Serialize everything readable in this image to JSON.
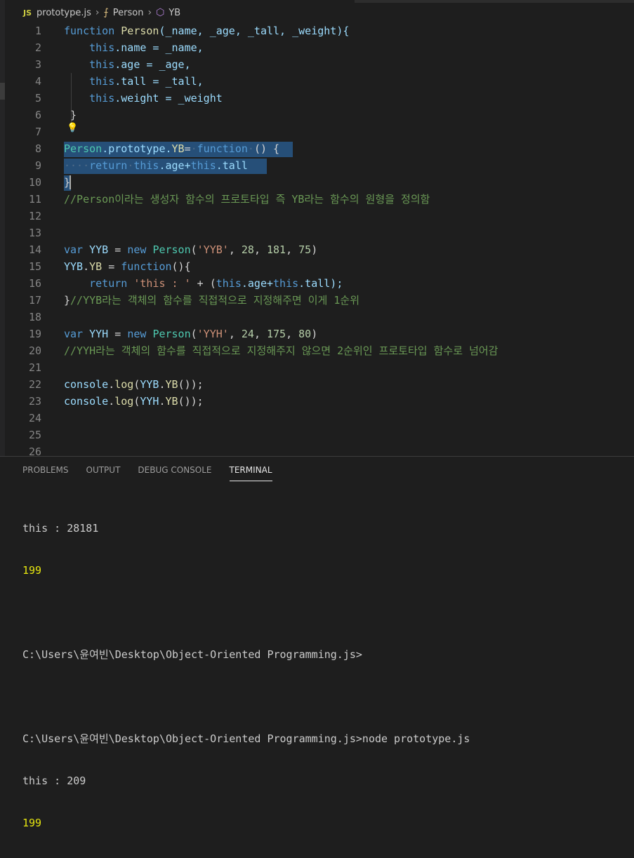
{
  "breadcrumb": {
    "file_badge": "JS",
    "file": "prototype.js",
    "symbol1": "Person",
    "symbol2": "YB"
  },
  "editor": {
    "line_numbers": [
      "1",
      "2",
      "3",
      "4",
      "5",
      "6",
      "7",
      "8",
      "9",
      "10",
      "11",
      "12",
      "13",
      "14",
      "15",
      "16",
      "17",
      "18",
      "19",
      "20",
      "21",
      "22",
      "23",
      "24",
      "25",
      "26"
    ],
    "lines": {
      "l1": {
        "a": "function",
        "b": "Person",
        "c": "(_name, _age, _tall, _weight){"
      },
      "l2": {
        "a": "this",
        "b": ".name = _name,",
        "c": ""
      },
      "l3": {
        "a": "this",
        "b": ".age = _age,",
        "c": ""
      },
      "l4": {
        "a": "this",
        "b": ".tall = _tall,",
        "c": ""
      },
      "l5": {
        "a": "this",
        "b": ".weight = _weight",
        "c": ""
      },
      "l6": {
        "a": "}",
        "b": "",
        "c": ""
      },
      "l8": {
        "a": "Person",
        "b": ".prototype.",
        "c": "YB",
        "d": "=",
        "e": "function",
        "f": "() {"
      },
      "l9": {
        "a": "····",
        "b": "return",
        "c": "this",
        "d": ".age+",
        "e": "this",
        "f": ".tall"
      },
      "l10": {
        "a": "}",
        "b": "",
        "c": ""
      },
      "l11": {
        "a": "//Person이라는 생성자 함수의 프로토타입 즉 YB라는 함수의 원형을 정의함"
      },
      "l14": {
        "a": "var",
        "b": "YYB",
        "c": "=",
        "d": "new",
        "e": "Person",
        "f": "(",
        "g": "'YYB'",
        "h": ", ",
        "i": "28",
        "j": ", ",
        "k": "181",
        "l": ", ",
        "m": "75",
        "n": ")"
      },
      "l15": {
        "a": "YYB",
        "b": ".",
        "c": "YB",
        "d": " = ",
        "e": "function",
        "f": "(){"
      },
      "l16": {
        "a": "return",
        "b": " ",
        "c": "'this : '",
        "d": " + (",
        "e": "this",
        "f": ".age+",
        "g": "this",
        "h": ".tall);"
      },
      "l17": {
        "a": "}",
        "b": "//YYB라는 객체의 함수를 직접적으로 지정해주면 이게 1순위"
      },
      "l19": {
        "a": "var",
        "b": "YYH",
        "c": "=",
        "d": "new",
        "e": "Person",
        "f": "(",
        "g": "'YYH'",
        "h": ", ",
        "i": "24",
        "j": ", ",
        "k": "175",
        "l": ", ",
        "m": "80",
        "n": ")"
      },
      "l20": {
        "a": "//YYH라는 객체의 함수를 직접적으로 지정해주지 않으면 2순위인 프로토타입 함수로 넘어감"
      },
      "l22": {
        "a": "console",
        "b": ".",
        "c": "log",
        "d": "(",
        "e": "YYB",
        "f": ".",
        "g": "YB",
        "h": "());"
      },
      "l23": {
        "a": "console",
        "b": ".",
        "c": "log",
        "d": "(",
        "e": "YYH",
        "f": ".",
        "g": "YB",
        "h": "());"
      }
    }
  },
  "panel": {
    "tabs": [
      "PROBLEMS",
      "OUTPUT",
      "DEBUG CONSOLE",
      "TERMINAL"
    ],
    "terminal": {
      "l1": "this : 28181",
      "l2": "199",
      "l3": "C:\\Users\\윤여빈\\Desktop\\Object-Oriented Programming.js>",
      "l4": "C:\\Users\\윤여빈\\Desktop\\Object-Oriented Programming.js>node prototype.js",
      "l5": "this : 209",
      "l6": "199"
    }
  },
  "colors": {
    "background": "#1e1e1e",
    "selection": "#264f78",
    "keyword": "#569cd6",
    "comment": "#6a9955",
    "string": "#ce9178",
    "number": "#b5cea8"
  }
}
